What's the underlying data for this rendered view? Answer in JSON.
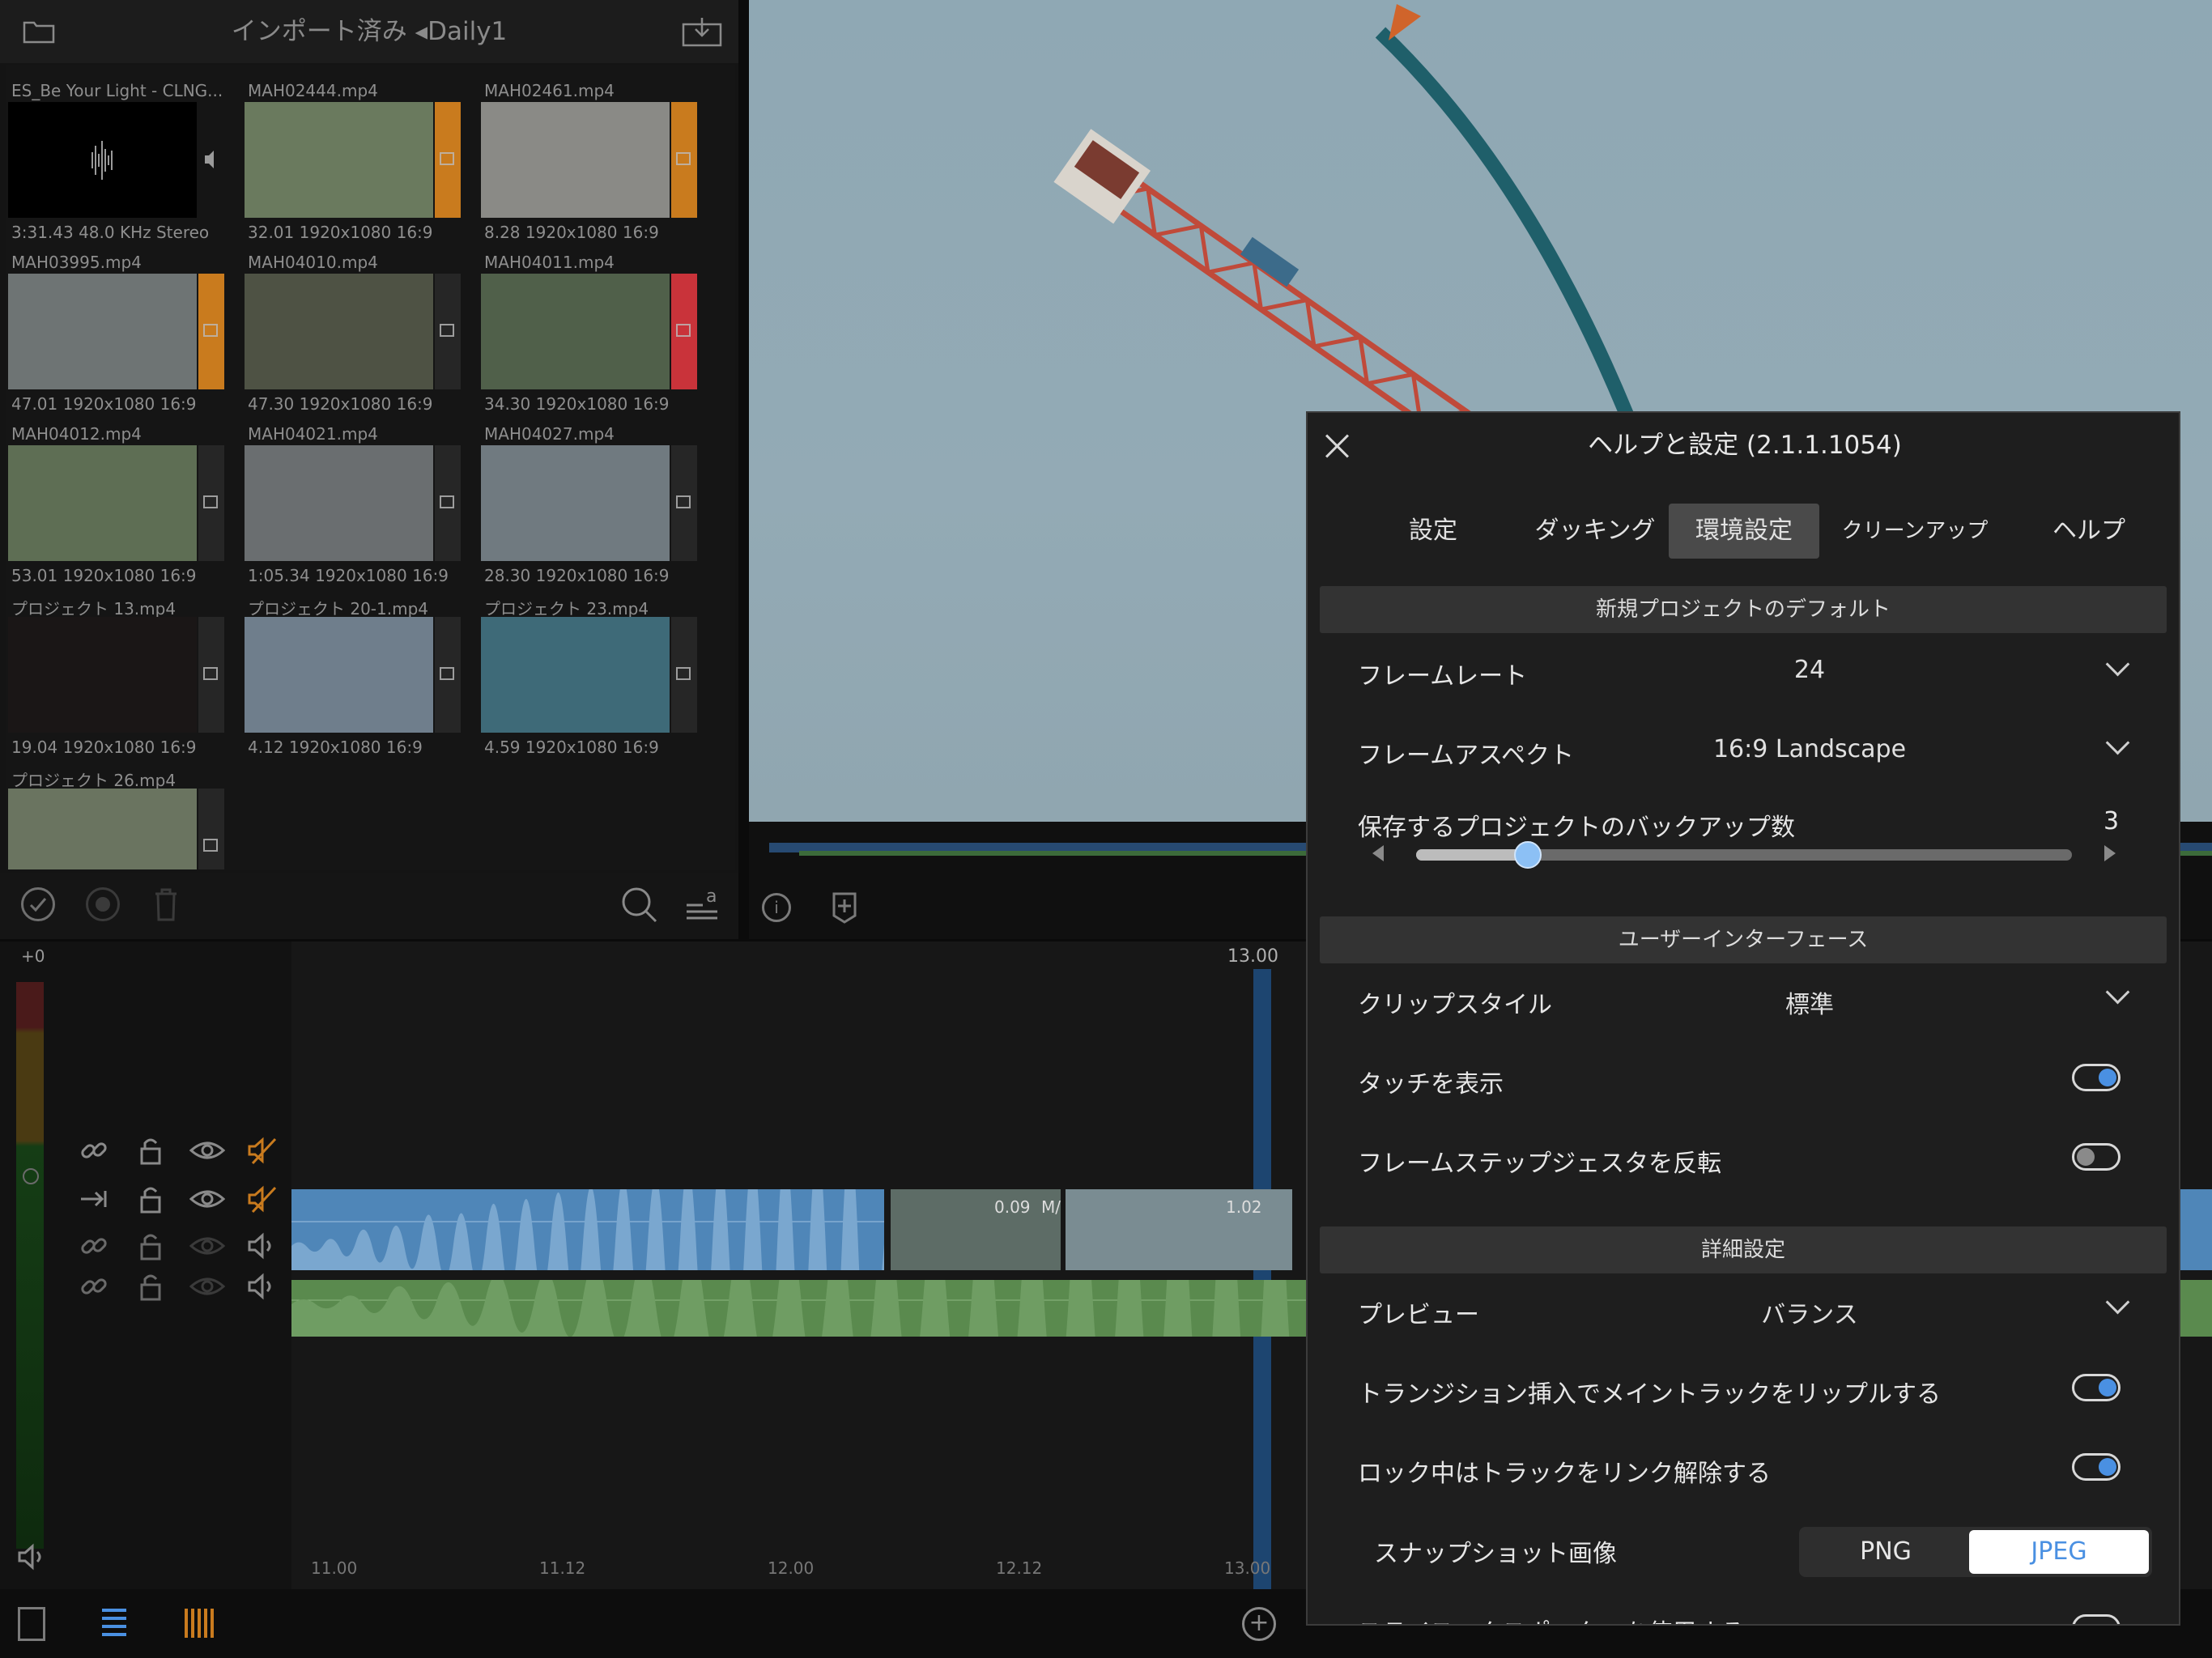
{
  "browser": {
    "title": "インポート済み ◂Daily1",
    "clips": [
      {
        "name": "ES_Be Your Light - CLNG...",
        "meta": "3:31.43  48.0 KHz  Stereo",
        "kind": "audio",
        "flag": ""
      },
      {
        "name": "MAH02444.mp4",
        "meta": "32.01  1920x1080  16:9",
        "kind": "video",
        "flag": "#c97b1e"
      },
      {
        "name": "MAH02461.mp4",
        "meta": "8.28  1920x1080  16:9",
        "kind": "video",
        "flag": "#c97b1e"
      },
      {
        "name": "MAH03995.mp4",
        "meta": "47.01  1920x1080  16:9",
        "kind": "video",
        "flag": "#c97b1e"
      },
      {
        "name": "MAH04010.mp4",
        "meta": "47.30  1920x1080  16:9",
        "kind": "video",
        "flag": ""
      },
      {
        "name": "MAH04011.mp4",
        "meta": "34.30  1920x1080  16:9",
        "kind": "video",
        "flag": "#c9333a"
      },
      {
        "name": "MAH04012.mp4",
        "meta": "53.01  1920x1080  16:9",
        "kind": "video",
        "flag": ""
      },
      {
        "name": "MAH04021.mp4",
        "meta": "1:05.34  1920x1080  16:9",
        "kind": "video",
        "flag": ""
      },
      {
        "name": "MAH04027.mp4",
        "meta": "28.30  1920x1080  16:9",
        "kind": "video",
        "flag": ""
      },
      {
        "name": "プロジェクト 13.mp4",
        "meta": "19.04  1920x1080  16:9",
        "kind": "project",
        "flag": ""
      },
      {
        "name": "プロジェクト 20-1.mp4",
        "meta": "4.12  1920x1080  16:9",
        "kind": "project",
        "flag": ""
      },
      {
        "name": "プロジェクト 23.mp4",
        "meta": "4.59  1920x1080  16:9",
        "kind": "project",
        "flag": ""
      },
      {
        "name": "プロジェクト 26.mp4",
        "meta": "",
        "kind": "project",
        "flag": ""
      }
    ]
  },
  "timeline": {
    "level_label": "+0",
    "playhead_label": "13.00",
    "ruler": [
      "11.00",
      "11.12",
      "12.00",
      "12.12",
      "13.00"
    ],
    "clip_labels": [
      "0.09",
      "M/",
      "1.02"
    ]
  },
  "dialog": {
    "title": "ヘルプと設定 (2.1.1.1054)",
    "tabs": [
      "設定",
      "ダッキング",
      "環境設定",
      "クリーンアップ",
      "ヘルプ"
    ],
    "active_tab": "環境設定",
    "sections": {
      "defaults": "新規プロジェクトのデフォルト",
      "ui": "ユーザーインターフェース",
      "advanced": "詳細設定"
    },
    "frame_rate": {
      "label": "フレームレート",
      "value": "24"
    },
    "frame_aspect": {
      "label": "フレームアスペクト",
      "value": "16:9  Landscape"
    },
    "backups": {
      "label": "保存するプロジェクトのバックアップ数",
      "value": "3",
      "fraction": 0.17
    },
    "clip_style": {
      "label": "クリップスタイル",
      "value": "標準"
    },
    "show_touch": {
      "label": "タッチを表示",
      "on": true
    },
    "invert_step": {
      "label": "フレームステップジェスタを反転",
      "on": false
    },
    "preview": {
      "label": "プレビュー",
      "value": "バランス"
    },
    "ripple": {
      "label": "トランジション挿入でメイントラックをリップルする",
      "on": true
    },
    "unlink": {
      "label": "ロック中はトラックをリンク解除する",
      "on": true
    },
    "snapshot": {
      "label": "スナップショット画像",
      "options": [
        "PNG",
        "JPEG"
      ],
      "selected": "JPEG"
    },
    "cut_off_row": {
      "label": "スライスエクスポーターを使用する"
    }
  },
  "colors": {
    "accent": "#4a90e2",
    "audio_blue": "#4f86b8",
    "audio_green": "#5a8a4e"
  }
}
